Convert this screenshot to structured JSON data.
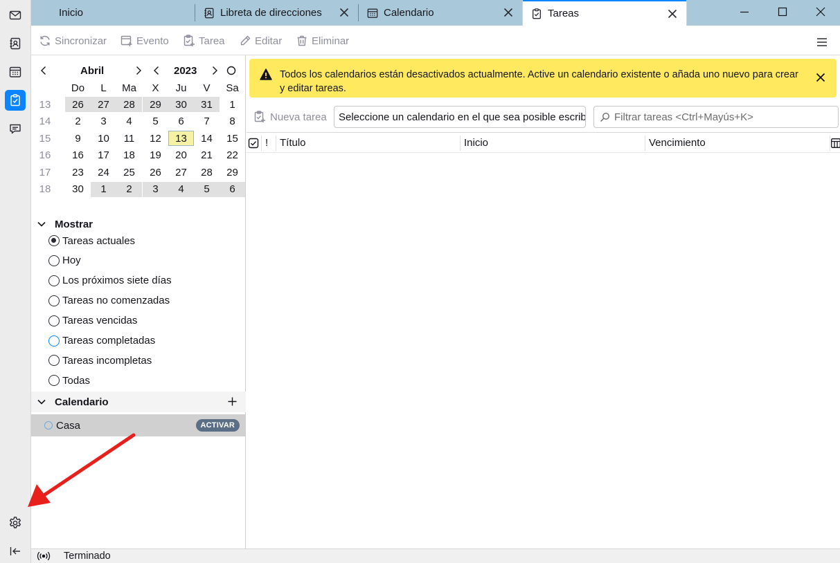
{
  "tabs": [
    {
      "label": "Inicio"
    },
    {
      "label": "Libreta de direcciones"
    },
    {
      "label": "Calendario"
    },
    {
      "label": "Tareas"
    }
  ],
  "toolbar": {
    "sync": "Sincronizar",
    "event": "Evento",
    "task": "Tarea",
    "edit": "Editar",
    "delete": "Eliminar"
  },
  "minimonth": {
    "month": "Abril",
    "year": "2023",
    "weekdays": [
      "Do",
      "L",
      "Ma",
      "X",
      "Ju",
      "V",
      "Sa"
    ],
    "weeks": [
      {
        "num": "13",
        "days": [
          "26",
          "27",
          "28",
          "29",
          "30",
          "31",
          "1"
        ]
      },
      {
        "num": "14",
        "days": [
          "2",
          "3",
          "4",
          "5",
          "6",
          "7",
          "8"
        ]
      },
      {
        "num": "15",
        "days": [
          "9",
          "10",
          "11",
          "12",
          "13",
          "14",
          "15"
        ]
      },
      {
        "num": "16",
        "days": [
          "16",
          "17",
          "18",
          "19",
          "20",
          "21",
          "22"
        ]
      },
      {
        "num": "17",
        "days": [
          "23",
          "24",
          "25",
          "26",
          "27",
          "28",
          "29"
        ]
      },
      {
        "num": "18",
        "days": [
          "30",
          "1",
          "2",
          "3",
          "4",
          "5",
          "6"
        ]
      }
    ]
  },
  "show": {
    "title": "Mostrar",
    "options": [
      "Tareas actuales",
      "Hoy",
      "Los próximos siete días",
      "Tareas no comenzadas",
      "Tareas vencidas",
      "Tareas completadas",
      "Tareas incompletas",
      "Todas"
    ]
  },
  "calendars": {
    "title": "Calendario",
    "items": [
      {
        "name": "Casa",
        "action": "ACTIVAR"
      }
    ]
  },
  "notice": {
    "text": "Todos los calendarios están desactivados actualmente. Active un calendario existente o añada uno nuevo para crear y editar tareas."
  },
  "tasks": {
    "new_task": "Nueva tarea",
    "calendar_select": "Seleccione un calendario en el que sea posible escribir",
    "filter_placeholder": "Filtrar tareas <Ctrl+Mayús+K>",
    "columns": {
      "priority": "!",
      "title": "Título",
      "start": "Inicio",
      "due": "Vencimiento"
    }
  },
  "status": {
    "text": "Terminado"
  },
  "colors": {
    "accent": "#0a84ff",
    "tabbar": "#a9c9da",
    "notice": "#ffe95f",
    "annotation_arrow": "#e8201c"
  }
}
